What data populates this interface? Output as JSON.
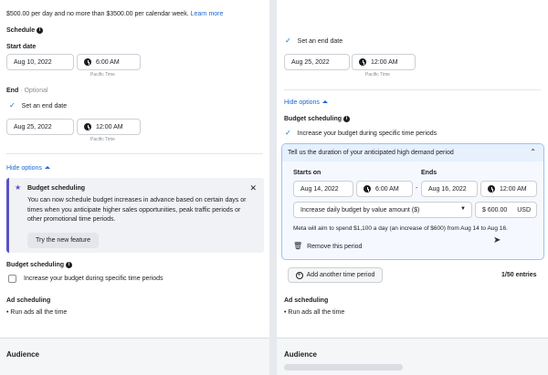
{
  "left": {
    "spend_note": "$500.00 per day and no more than $3500.00 per calendar week.",
    "learn_more": "Learn more",
    "schedule_title": "Schedule",
    "start_date_label": "Start date",
    "start_date": "Aug 10, 2022",
    "start_time": "6:00 AM",
    "start_tz": "Pacific Time",
    "end_label": "End",
    "optional": "· Optional",
    "set_end_date": "Set an end date",
    "end_date": "Aug 25, 2022",
    "end_time": "12:00 AM",
    "end_tz": "Pacific Time",
    "hide_options": "Hide options",
    "promo_title": "Budget scheduling",
    "promo_body": "You can now schedule budget increases in advance based on certain days or times when you anticipate higher sales opportunities, peak traffic periods or other promotional time periods.",
    "promo_button": "Try the new feature",
    "budget_scheduling_title": "Budget scheduling",
    "increase_budget": "Increase your budget during specific time periods",
    "ad_scheduling_title": "Ad scheduling",
    "run_ads": "• Run ads all the time",
    "audience": "Audience"
  },
  "right": {
    "set_end_date": "Set an end date",
    "end_date": "Aug 25, 2022",
    "end_time": "12:00 AM",
    "end_tz": "Pacific Time",
    "hide_options": "Hide options",
    "budget_scheduling_title": "Budget scheduling",
    "increase_budget": "Increase your budget during specific time periods",
    "period_header": "Tell us the duration of your anticipated high demand period",
    "starts_on": "Starts on",
    "ends": "Ends",
    "start_date": "Aug 14, 2022",
    "start_time": "6:00 AM",
    "dash": "-",
    "end_date2": "Aug 16, 2022",
    "end_time2": "12:00 AM",
    "increase_select": "Increase daily budget by value amount ($)",
    "amount": "$ 600.00",
    "currency": "USD",
    "meta_note": "Meta will aim to spend $1,100 a day (an increase of $600) from Aug 14 to Aug 16.",
    "remove_period": "Remove this period",
    "add_period": "Add another time period",
    "entries": "1/50 entries",
    "ad_scheduling_title": "Ad scheduling",
    "run_ads": "• Run ads all the time",
    "audience": "Audience"
  }
}
